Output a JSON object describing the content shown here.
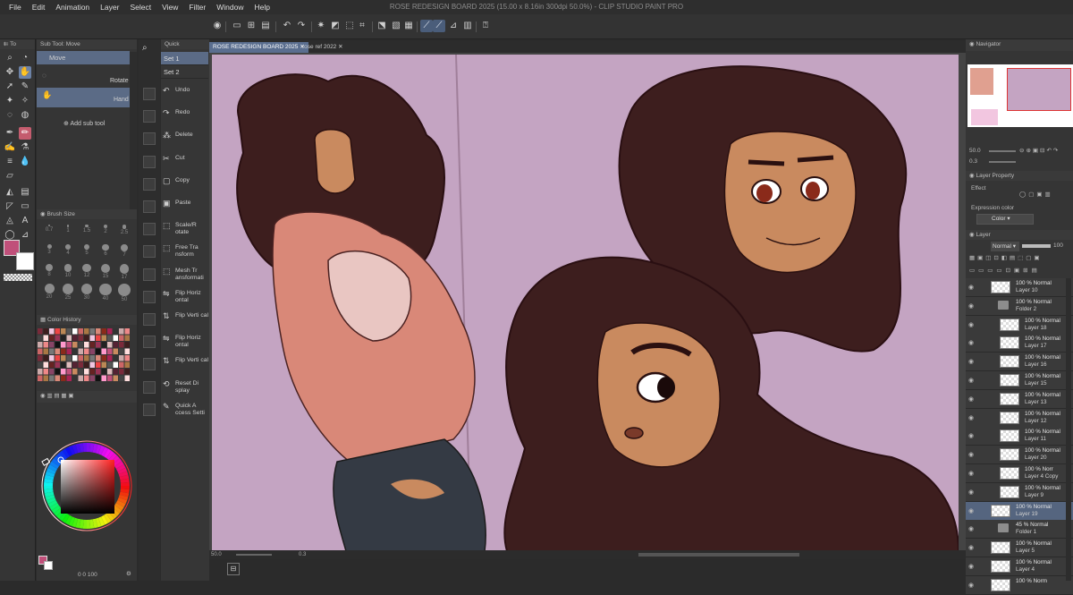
{
  "app": {
    "title": "ROSE REDESIGN BOARD 2025 (15.00 x 8.16in 300dpi 50.0%) - CLIP STUDIO PAINT PRO"
  },
  "menu": [
    "File",
    "Edit",
    "Animation",
    "Layer",
    "Select",
    "View",
    "Filter",
    "Window",
    "Help"
  ],
  "subtool": {
    "header": "Sub Tool: Move",
    "items": [
      "Move",
      "Rotate",
      "Hand"
    ],
    "add_label": "Add sub tool"
  },
  "brushsize": {
    "header": "Brush Size",
    "values": [
      "0.7",
      "1",
      "1.5",
      "2",
      "2.5",
      "3",
      "4",
      "5",
      "6",
      "7",
      "8",
      "10",
      "12",
      "15",
      "17",
      "20",
      "25",
      "30",
      "40",
      "50"
    ]
  },
  "history": {
    "header": "Color History"
  },
  "quick": {
    "header": "Quick",
    "sets": [
      "Set 1",
      "Set 2"
    ],
    "actions": [
      {
        "label": "Undo",
        "icon": "↶"
      },
      {
        "label": "Redo",
        "icon": "↷"
      },
      {
        "label": "Delete",
        "icon": "⁂"
      },
      {
        "label": "Cut",
        "icon": "✂"
      },
      {
        "label": "Copy",
        "icon": "▢"
      },
      {
        "label": "Paste",
        "icon": "▣"
      },
      {
        "label": "Scale/R otate",
        "icon": "⬚"
      },
      {
        "label": "Free Tra nsform",
        "icon": "⬚"
      },
      {
        "label": "Mesh Tr ansformati",
        "icon": "⬚"
      },
      {
        "label": "Flip Horiz ontal",
        "icon": "⇋"
      },
      {
        "label": "Flip Verti cal",
        "icon": "⇅"
      },
      {
        "label": "Flip Horiz ontal",
        "icon": "⇋"
      },
      {
        "label": "Flip Verti cal",
        "icon": "⇅"
      },
      {
        "label": "Reset Di splay",
        "icon": "⟲"
      },
      {
        "label": "Quick A ccess Setti",
        "icon": "✎"
      }
    ]
  },
  "tabs": [
    "ROSE REDESIGN BOARD 2025",
    "rose ref 2022"
  ],
  "status": {
    "zoom": "50.0",
    "angle": "0.3",
    "color_values": "0 0 100"
  },
  "navigator": {
    "header": "Navigator",
    "zoom": "50.0",
    "angle": "0.3"
  },
  "layer_property": {
    "header": "Layer Property",
    "effect": "Effect",
    "expression_label": "Expression color",
    "expression_value": "Color"
  },
  "layers_panel": {
    "header": "Layer",
    "blend": "Normal",
    "opacity": "100"
  },
  "layers": [
    {
      "l1": "100 % Normal",
      "l2": "Layer 10",
      "type": "layer",
      "indent": 0
    },
    {
      "l1": "100 % Normal",
      "l2": "Folder 2",
      "type": "folder",
      "indent": 0
    },
    {
      "l1": "100 % Normal",
      "l2": "Layer 18",
      "type": "layer",
      "indent": 1
    },
    {
      "l1": "100 % Normal",
      "l2": "Layer 17",
      "type": "layer",
      "indent": 1
    },
    {
      "l1": "100 % Normal",
      "l2": "Layer 16",
      "type": "layer",
      "indent": 1
    },
    {
      "l1": "100 % Normal",
      "l2": "Layer 15",
      "type": "layer",
      "indent": 1
    },
    {
      "l1": "100 % Normal",
      "l2": "Layer 13",
      "type": "layer",
      "indent": 1
    },
    {
      "l1": "100 % Normal",
      "l2": "Layer 12",
      "type": "layer",
      "indent": 1
    },
    {
      "l1": "100 % Normal",
      "l2": "Layer 11",
      "type": "layer",
      "indent": 1
    },
    {
      "l1": "100 % Normal",
      "l2": "Layer 20",
      "type": "layer",
      "indent": 1
    },
    {
      "l1": "100 % Norr",
      "l2": "Layer 4 Copy",
      "type": "layer",
      "indent": 1
    },
    {
      "l1": "100 % Normal",
      "l2": "Layer 9",
      "type": "layer",
      "indent": 1
    },
    {
      "l1": "100 % Normal",
      "l2": "Layer 19",
      "type": "layer",
      "indent": 0,
      "selected": true
    },
    {
      "l1": "45 % Normal",
      "l2": "Folder 1",
      "type": "folder",
      "indent": 0
    },
    {
      "l1": "100 % Normal",
      "l2": "Layer 5",
      "type": "layer",
      "indent": 0
    },
    {
      "l1": "100 % Normal",
      "l2": "Layer 4",
      "type": "layer",
      "indent": 0
    },
    {
      "l1": "100 % Norm",
      "l2": "",
      "type": "layer",
      "indent": 0
    }
  ],
  "colors": {
    "main": "#c0507a",
    "sub": "#ffffff",
    "canvas": "#c4a4c2",
    "hair": "#3d1e1e",
    "skin": "#c98a5f",
    "hoodie": "#d98878"
  }
}
